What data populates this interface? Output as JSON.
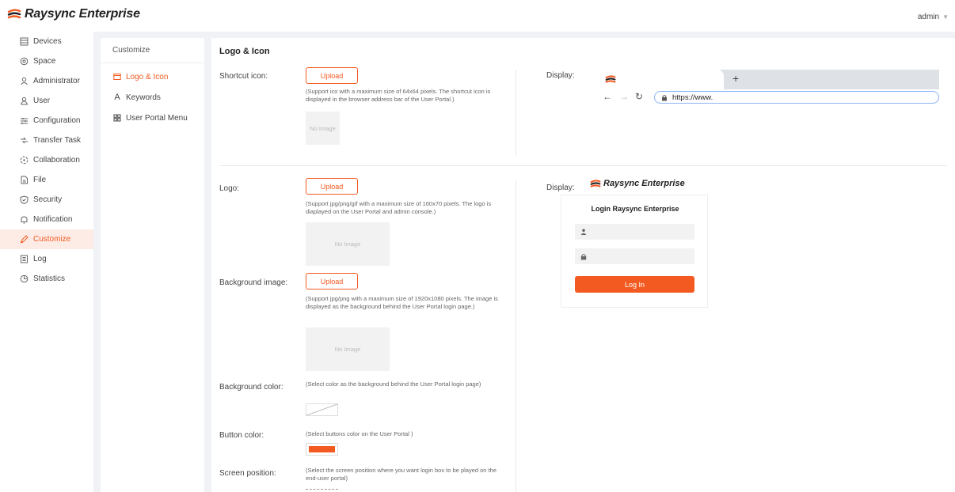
{
  "app": {
    "brand": "Raysync Enterprise",
    "user": "admin",
    "accent": "#f25a22"
  },
  "sidebar": {
    "items": [
      {
        "label": "Devices",
        "icon": "devices-icon"
      },
      {
        "label": "Space",
        "icon": "space-icon"
      },
      {
        "label": "Administrator",
        "icon": "administrator-icon"
      },
      {
        "label": "User",
        "icon": "user-icon"
      },
      {
        "label": "Configuration",
        "icon": "configuration-icon"
      },
      {
        "label": "Transfer Task",
        "icon": "transfer-task-icon"
      },
      {
        "label": "Collaboration",
        "icon": "collaboration-icon"
      },
      {
        "label": "File",
        "icon": "file-icon"
      },
      {
        "label": "Security",
        "icon": "security-icon"
      },
      {
        "label": "Notification",
        "icon": "notification-icon"
      },
      {
        "label": "Customize",
        "icon": "customize-icon",
        "active": true
      },
      {
        "label": "Log",
        "icon": "log-icon"
      },
      {
        "label": "Statistics",
        "icon": "statistics-icon"
      }
    ]
  },
  "subnav": {
    "title": "Customize",
    "items": [
      {
        "label": "Logo & Icon",
        "icon": "image-icon",
        "active": true
      },
      {
        "label": "Keywords",
        "icon": "keywords-icon"
      },
      {
        "label": "User Portal Menu",
        "icon": "grid-icon"
      }
    ]
  },
  "main": {
    "title": "Logo & Icon",
    "upload_label": "Upload",
    "no_image": "No Image",
    "display_label": "Display:",
    "shortcut": {
      "label": "Shortcut icon:",
      "hint": "(Support ico with a maximum size of 64x64 pixels. The shortcut icon is displayed in the browser address bar of the User Portal.)"
    },
    "logo": {
      "label": "Logo:",
      "hint": "(Support jpg/png/gif with a maximum size of 160x70 pixels. The logo is diaplayed on the User Portal and admin console.)"
    },
    "background_image": {
      "label": "Background image:",
      "hint": "(Support jpg/png with a maximum size of 1920x1080 pixels. The image is displayed as the background behind the User Portal login page.)"
    },
    "background_color": {
      "label": "Background color:",
      "hint": "(Select color as the background behind the User Portal login page)"
    },
    "button_color": {
      "label": "Button color:",
      "hint": "(Select buttons color on the User Portal )",
      "color": "#f25a22"
    },
    "screen_position": {
      "label": "Screen position:",
      "hint": "(Select the screen position where you want login box to be played on the end-user portal)"
    }
  },
  "browser_preview": {
    "url": "https://www.",
    "new_tab": "+"
  },
  "login_preview": {
    "brand": "Raysync Enterprise",
    "title": "Login Raysync Enterprise",
    "button": "Log In"
  }
}
